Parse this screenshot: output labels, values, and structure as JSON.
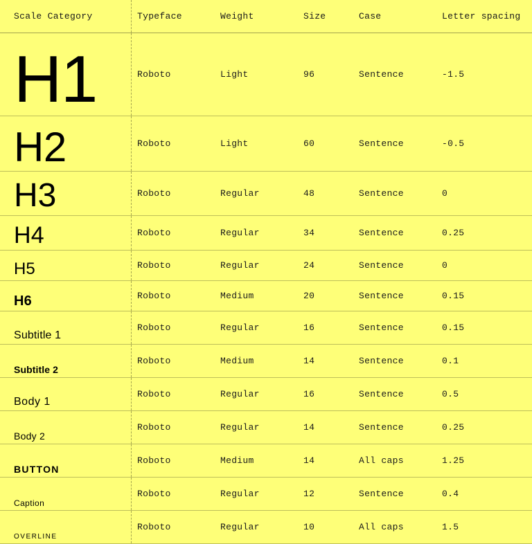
{
  "chart_data": {
    "type": "table",
    "title": "",
    "columns": [
      "Scale Category",
      "Typeface",
      "Weight",
      "Size",
      "Case",
      "Letter spacing"
    ],
    "rows": [
      {
        "label": "H1",
        "typeface": "Roboto",
        "weight": "Light",
        "size": "96",
        "case": "Sentence",
        "letter_spacing": "-1.5",
        "style": {
          "font_size": 96,
          "font_weight": 300,
          "uppercase": false,
          "letter_spacing_px": -1.5,
          "row": 120
        }
      },
      {
        "label": "H2",
        "typeface": "Roboto",
        "weight": "Light",
        "size": "60",
        "case": "Sentence",
        "letter_spacing": "-0.5",
        "style": {
          "font_size": 60,
          "font_weight": 300,
          "uppercase": false,
          "letter_spacing_px": -0.5,
          "row": 80
        }
      },
      {
        "label": "H3",
        "typeface": "Roboto",
        "weight": "Regular",
        "size": "48",
        "case": "Sentence",
        "letter_spacing": "0",
        "style": {
          "font_size": 48,
          "font_weight": 400,
          "uppercase": false,
          "letter_spacing_px": 0,
          "row": 64
        }
      },
      {
        "label": "H4",
        "typeface": "Roboto",
        "weight": "Regular",
        "size": "34",
        "case": "Sentence",
        "letter_spacing": "0.25",
        "style": {
          "font_size": 34,
          "font_weight": 400,
          "uppercase": false,
          "letter_spacing_px": 0.25,
          "row": 50
        }
      },
      {
        "label": "H5",
        "typeface": "Roboto",
        "weight": "Regular",
        "size": "24",
        "case": "Sentence",
        "letter_spacing": "0",
        "style": {
          "font_size": 24,
          "font_weight": 400,
          "uppercase": false,
          "letter_spacing_px": 0,
          "row": 44
        }
      },
      {
        "label": "H6",
        "typeface": "Roboto",
        "weight": "Medium",
        "size": "20",
        "case": "Sentence",
        "letter_spacing": "0.15",
        "style": {
          "font_size": 20,
          "font_weight": 600,
          "uppercase": false,
          "letter_spacing_px": 0.15,
          "row": 44
        }
      },
      {
        "label": "Subtitle 1",
        "typeface": "Roboto",
        "weight": "Regular",
        "size": "16",
        "case": "Sentence",
        "letter_spacing": "0.15",
        "style": {
          "font_size": 16,
          "font_weight": 400,
          "uppercase": false,
          "letter_spacing_px": 0.15,
          "row": 48
        }
      },
      {
        "label": "Subtitle 2",
        "typeface": "Roboto",
        "weight": "Medium",
        "size": "14",
        "case": "Sentence",
        "letter_spacing": "0.1",
        "style": {
          "font_size": 14,
          "font_weight": 600,
          "uppercase": false,
          "letter_spacing_px": 0.1,
          "row": 48
        }
      },
      {
        "label": "Body 1",
        "typeface": "Roboto",
        "weight": "Regular",
        "size": "16",
        "case": "Sentence",
        "letter_spacing": "0.5",
        "style": {
          "font_size": 16,
          "font_weight": 400,
          "uppercase": false,
          "letter_spacing_px": 0.5,
          "row": 48
        }
      },
      {
        "label": "Body 2",
        "typeface": "Roboto",
        "weight": "Regular",
        "size": "14",
        "case": "Sentence",
        "letter_spacing": "0.25",
        "style": {
          "font_size": 14,
          "font_weight": 400,
          "uppercase": false,
          "letter_spacing_px": 0.25,
          "row": 48
        }
      },
      {
        "label": "BUTTON",
        "typeface": "Roboto",
        "weight": "Medium",
        "size": "14",
        "case": "All caps",
        "letter_spacing": "1.25",
        "style": {
          "font_size": 14,
          "font_weight": 600,
          "uppercase": true,
          "letter_spacing_px": 1.25,
          "row": 48
        }
      },
      {
        "label": "Caption",
        "typeface": "Roboto",
        "weight": "Regular",
        "size": "12",
        "case": "Sentence",
        "letter_spacing": "0.4",
        "style": {
          "font_size": 12,
          "font_weight": 400,
          "uppercase": false,
          "letter_spacing_px": 0.4,
          "row": 48
        }
      },
      {
        "label": "OVERLINE",
        "typeface": "Roboto",
        "weight": "Regular",
        "size": "10",
        "case": "All caps",
        "letter_spacing": "1.5",
        "style": {
          "font_size": 10,
          "font_weight": 400,
          "uppercase": true,
          "letter_spacing_px": 1.5,
          "row": 48
        }
      }
    ]
  }
}
